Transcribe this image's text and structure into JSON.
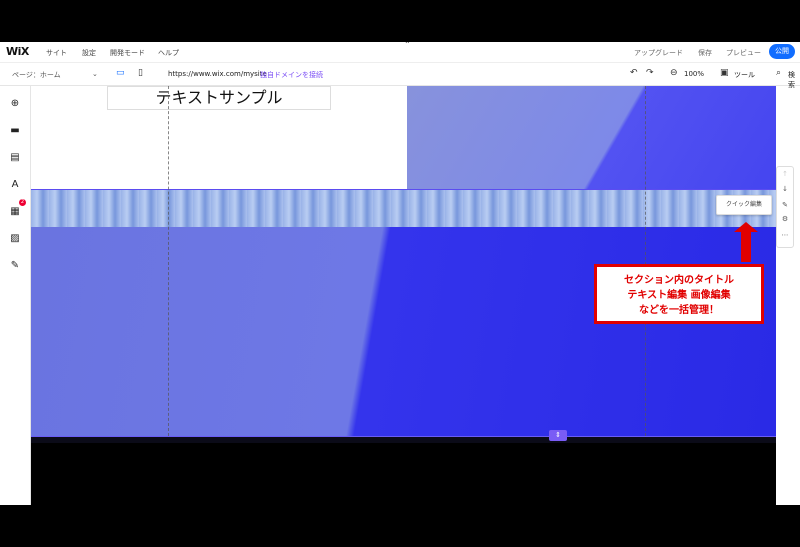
{
  "topbar": {
    "logo": "WiX",
    "nav": [
      "サイト",
      "設定",
      "開発モード",
      "ヘルプ"
    ],
    "upgrade": "アップグレード",
    "save": "保存",
    "preview": "プレビュー",
    "publish": "公開"
  },
  "toolbar": {
    "page_label": "ページ：ホーム",
    "url": "https://www.wix.com/mysite",
    "connect_domain": "独自ドメインを接続",
    "zoom": "100%",
    "tools": "ツール",
    "search": "検索"
  },
  "canvas": {
    "text_sample": "テキストサンプル",
    "quick_edit_tooltip": "クイック編集"
  },
  "annotation": {
    "line1": "セクション内のタイトル",
    "line2": "テキスト編集 画像編集",
    "line3": "などを一括管理！"
  },
  "rail": {
    "badge_count": "2"
  },
  "colors": {
    "accent": "#116dff",
    "annotation": "#e10000",
    "selection": "#6a5cf5"
  }
}
